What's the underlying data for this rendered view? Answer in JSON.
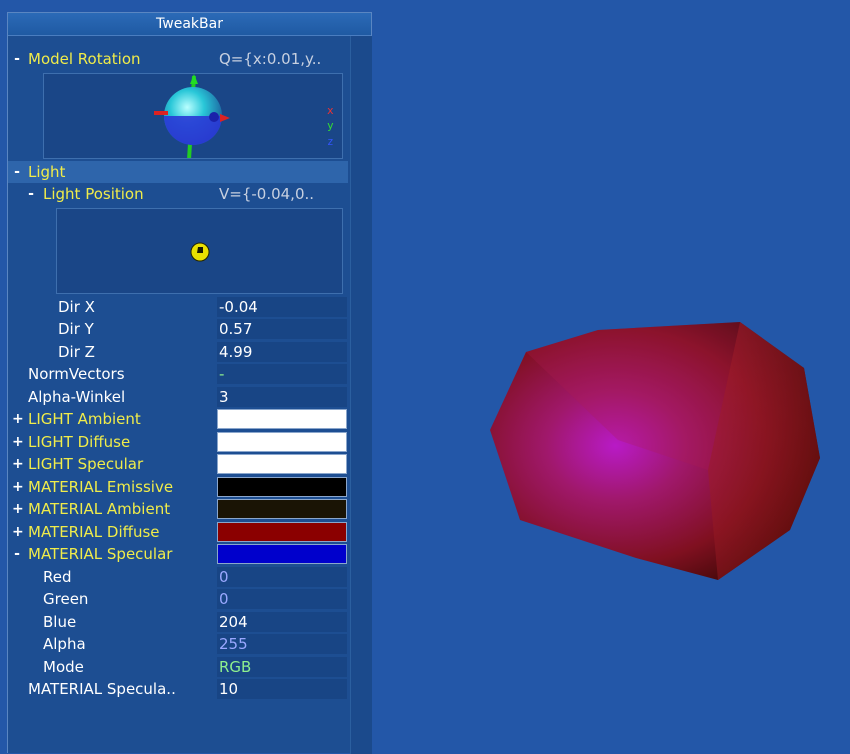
{
  "bar_title": "TweakBar",
  "model_rotation": {
    "label": "Model Rotation",
    "value": "Q={x:0.01,y..",
    "axes": [
      "x",
      "y",
      "z"
    ]
  },
  "light": {
    "label": "Light"
  },
  "light_position": {
    "label": "Light Position",
    "value": "V={-0.04,0.."
  },
  "dir": [
    {
      "label": "Dir X",
      "value": "-0.04"
    },
    {
      "label": "Dir Y",
      "value": "0.57"
    },
    {
      "label": "Dir Z",
      "value": "4.99"
    }
  ],
  "norm_vectors": {
    "label": "NormVectors",
    "value": "-"
  },
  "alpha_winkel": {
    "label": "Alpha-Winkel",
    "value": "3"
  },
  "colors": [
    {
      "label": "LIGHT Ambient",
      "toggle": "+",
      "color": "#ffffff"
    },
    {
      "label": "LIGHT Diffuse",
      "toggle": "+",
      "color": "#ffffff"
    },
    {
      "label": "LIGHT Specular",
      "toggle": "+",
      "color": "#ffffff"
    },
    {
      "label": "MATERIAL Emissive",
      "toggle": "+",
      "color": "#000000"
    },
    {
      "label": "MATERIAL Ambient",
      "toggle": "+",
      "color": "#1a1405"
    },
    {
      "label": "MATERIAL Diffuse",
      "toggle": "+",
      "color": "#8b0000"
    },
    {
      "label": "MATERIAL Specular",
      "toggle": "-",
      "color": "#0000cc"
    }
  ],
  "specular_components": [
    {
      "label": "Red",
      "value": "0",
      "value_color": "#9aa8ff"
    },
    {
      "label": "Green",
      "value": "0",
      "value_color": "#9aa8ff"
    },
    {
      "label": "Blue",
      "value": "204",
      "value_color": "#ffffff"
    },
    {
      "label": "Alpha",
      "value": "255",
      "value_color": "#9aa8ff"
    },
    {
      "label": "Mode",
      "value": "RGB",
      "value_color": "#8ef08e"
    }
  ],
  "specular_power": {
    "label": "MATERIAL Specula..",
    "value": "10"
  },
  "theme": {
    "background": "#2357a8",
    "bar": "#1d4e92",
    "label_yellow": "#f0ec4a"
  }
}
